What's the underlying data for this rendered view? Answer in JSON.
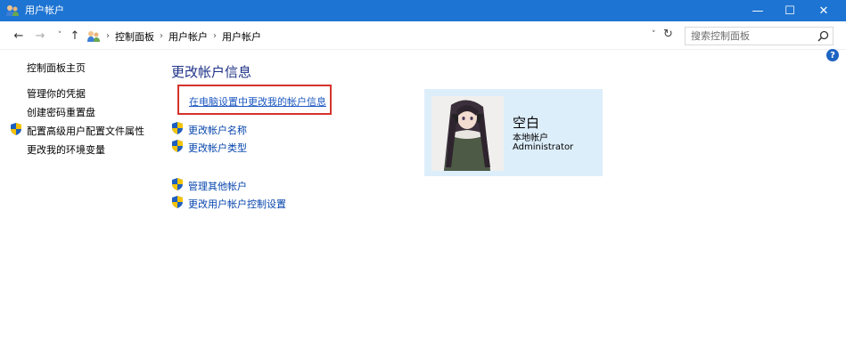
{
  "window": {
    "title": "用户帐户",
    "buttons": {
      "minimize": "—",
      "maximize": "☐",
      "close": "✕"
    }
  },
  "navigation": {
    "back": "←",
    "forward": "→",
    "recent": "˅",
    "up": "↑",
    "breadcrumbs": [
      "控制面板",
      "用户帐户",
      "用户帐户"
    ],
    "dropdown": "˅",
    "refresh": "↻"
  },
  "search": {
    "placeholder": "搜索控制面板"
  },
  "help": {
    "label": "?"
  },
  "sidebar": {
    "home": "控制面板主页",
    "items": [
      {
        "label": "管理你的凭据",
        "shield": false
      },
      {
        "label": "创建密码重置盘",
        "shield": false
      },
      {
        "label": "配置高级用户配置文件属性",
        "shield": true
      },
      {
        "label": "更改我的环境变量",
        "shield": false
      }
    ]
  },
  "main": {
    "title": "更改帐户信息",
    "primary_link": "在电脑设置中更改我的帐户信息",
    "links": [
      {
        "label": "更改帐户名称",
        "shield": true
      },
      {
        "label": "更改帐户类型",
        "shield": true
      },
      {
        "label": "管理其他帐户",
        "shield": true
      },
      {
        "label": "更改用户帐户控制设置",
        "shield": true
      }
    ]
  },
  "account": {
    "name": "空白",
    "type": "本地帐户",
    "role": "Administrator",
    "avatar_icon": "anime-character-avatar"
  },
  "colors": {
    "titlebar": "#1e74d2",
    "link": "#0645ad",
    "title_text": "#1e3287",
    "card_bg": "#ddeefb",
    "highlight": "#d4332b"
  }
}
